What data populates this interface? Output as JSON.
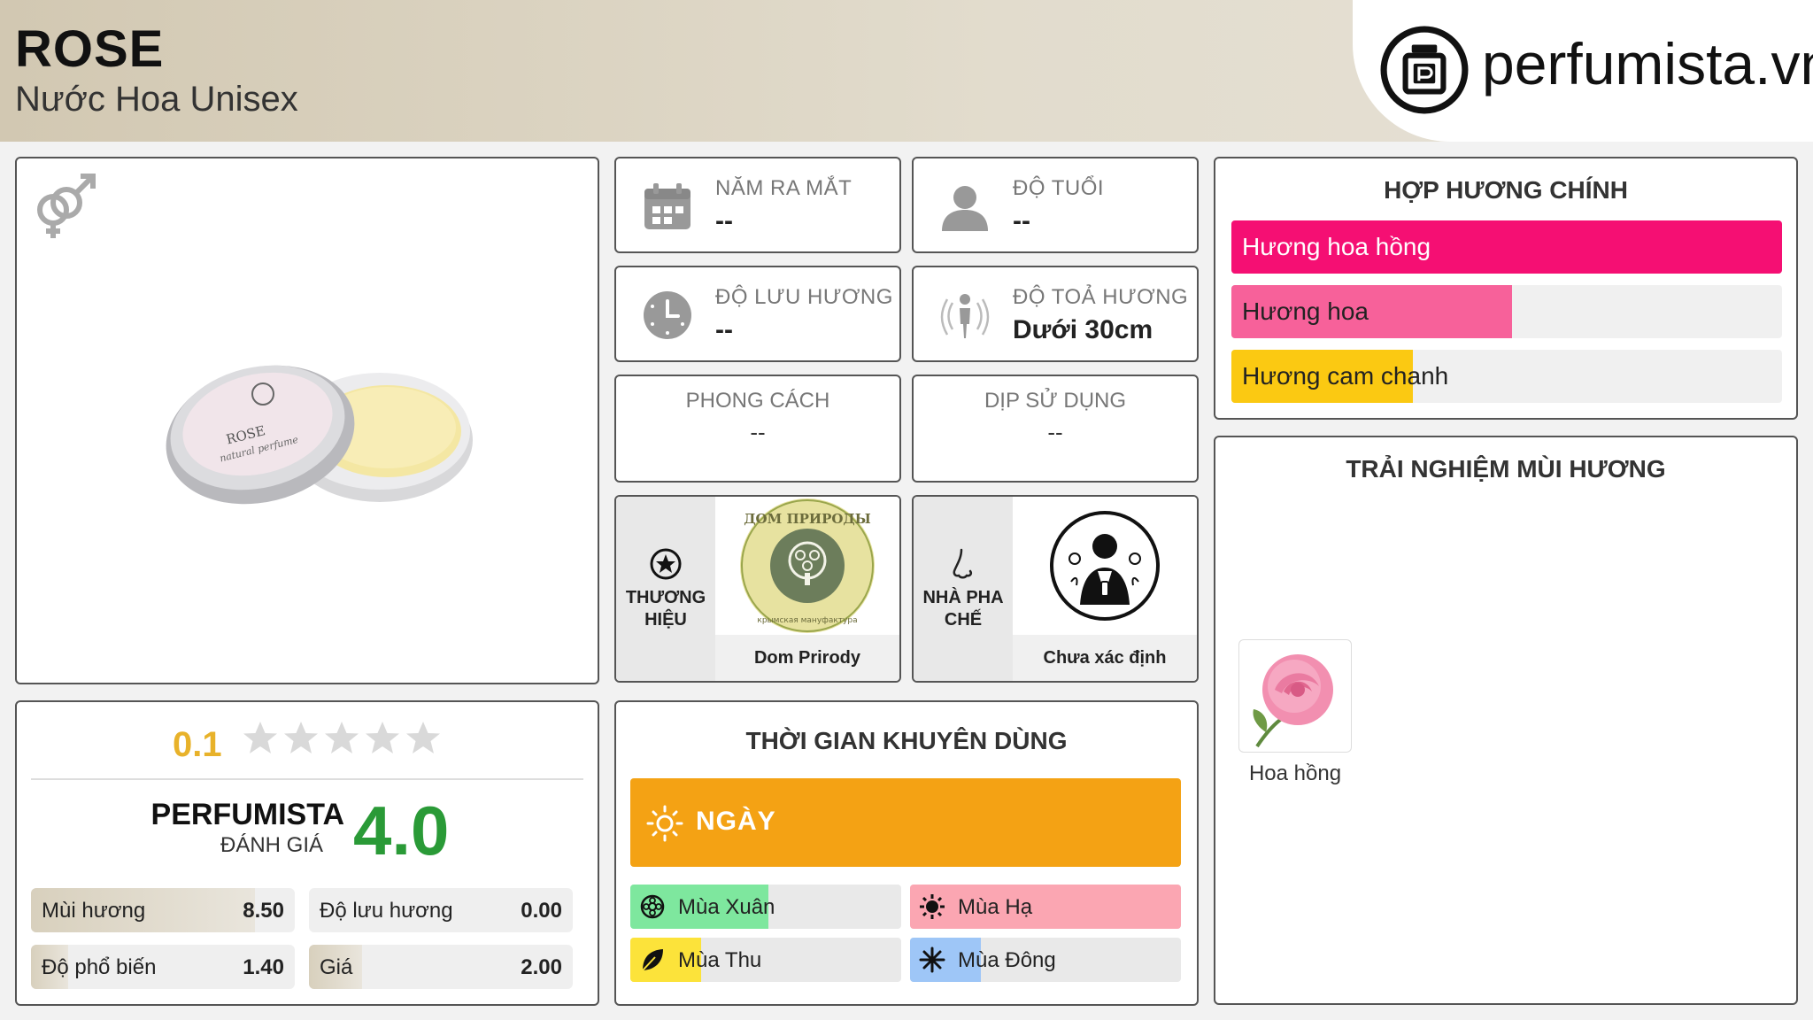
{
  "product": {
    "name": "ROSE",
    "subtitle": "Nước Hoa Unisex"
  },
  "brand": {
    "site": "perfumista.vn"
  },
  "image_panel": {
    "gender": "unisex-gender-icon",
    "tin_lines": [
      "ROSE",
      "natural perfume"
    ]
  },
  "info": {
    "launch_year": {
      "label": "NĂM RA MẮT",
      "value": "--"
    },
    "age": {
      "label": "ĐỘ TUỔI",
      "value": "--"
    },
    "longevity": {
      "label": "ĐỘ LƯU HƯƠNG",
      "value": "--"
    },
    "sillage": {
      "label": "ĐỘ TOẢ HƯƠNG",
      "value": "Dưới 30cm"
    },
    "style": {
      "label": "PHONG CÁCH",
      "value": "--"
    },
    "occasion": {
      "label": "DỊP SỬ DỤNG",
      "value": "--"
    }
  },
  "brand_tile": {
    "label": "THƯƠNG HIỆU",
    "value": "Dom Prirody",
    "logo_text": "ДОМ ПРИРОДЫ",
    "logo_subtext": "крымская мануфактура"
  },
  "perfumer_tile": {
    "label": "NHÀ PHA CHẾ",
    "value": "Chưa xác định"
  },
  "accords": {
    "title": "HỢP HƯƠNG CHÍNH",
    "items": [
      {
        "label": "Hương hoa hồng",
        "percent": 100,
        "color": "#f50f73"
      },
      {
        "label": "Hương hoa",
        "percent": 51,
        "color": "#f7619a"
      },
      {
        "label": "Hương cam chanh",
        "percent": 33,
        "color": "#fbc912"
      }
    ]
  },
  "notes": {
    "title": "TRẢI NGHIỆM MÙI HƯƠNG",
    "items": [
      {
        "label": "Hoa hồng",
        "icon": "rose-flower-image"
      }
    ]
  },
  "rating": {
    "user_score": "0.1",
    "stars_out_of": 5,
    "pf_title": "PERFUMISTA",
    "pf_subtitle": "ĐÁNH GIÁ",
    "pf_score": "4.0",
    "metrics": [
      {
        "label": "Mùi hương",
        "value": "8.50",
        "fraction": 0.85
      },
      {
        "label": "Độ lưu hương",
        "value": "0.00",
        "fraction": 0.0
      },
      {
        "label": "Độ phổ biến",
        "value": "1.40",
        "fraction": 0.14
      },
      {
        "label": "Giá",
        "value": "2.00",
        "fraction": 0.2
      }
    ]
  },
  "time": {
    "title": "THỜI GIAN KHUYÊN DÙNG",
    "day": {
      "label": "NGÀY"
    },
    "seasons": [
      {
        "label": "Mùa Xuân",
        "fraction": 0.51,
        "color": "#7ee79e"
      },
      {
        "label": "Mùa Hạ",
        "fraction": 1.0,
        "color": "#fba6b2"
      },
      {
        "label": "Mùa Thu",
        "fraction": 0.26,
        "color": "#fce33a"
      },
      {
        "label": "Mùa Đông",
        "fraction": 0.26,
        "color": "#9ec6f7"
      }
    ]
  }
}
